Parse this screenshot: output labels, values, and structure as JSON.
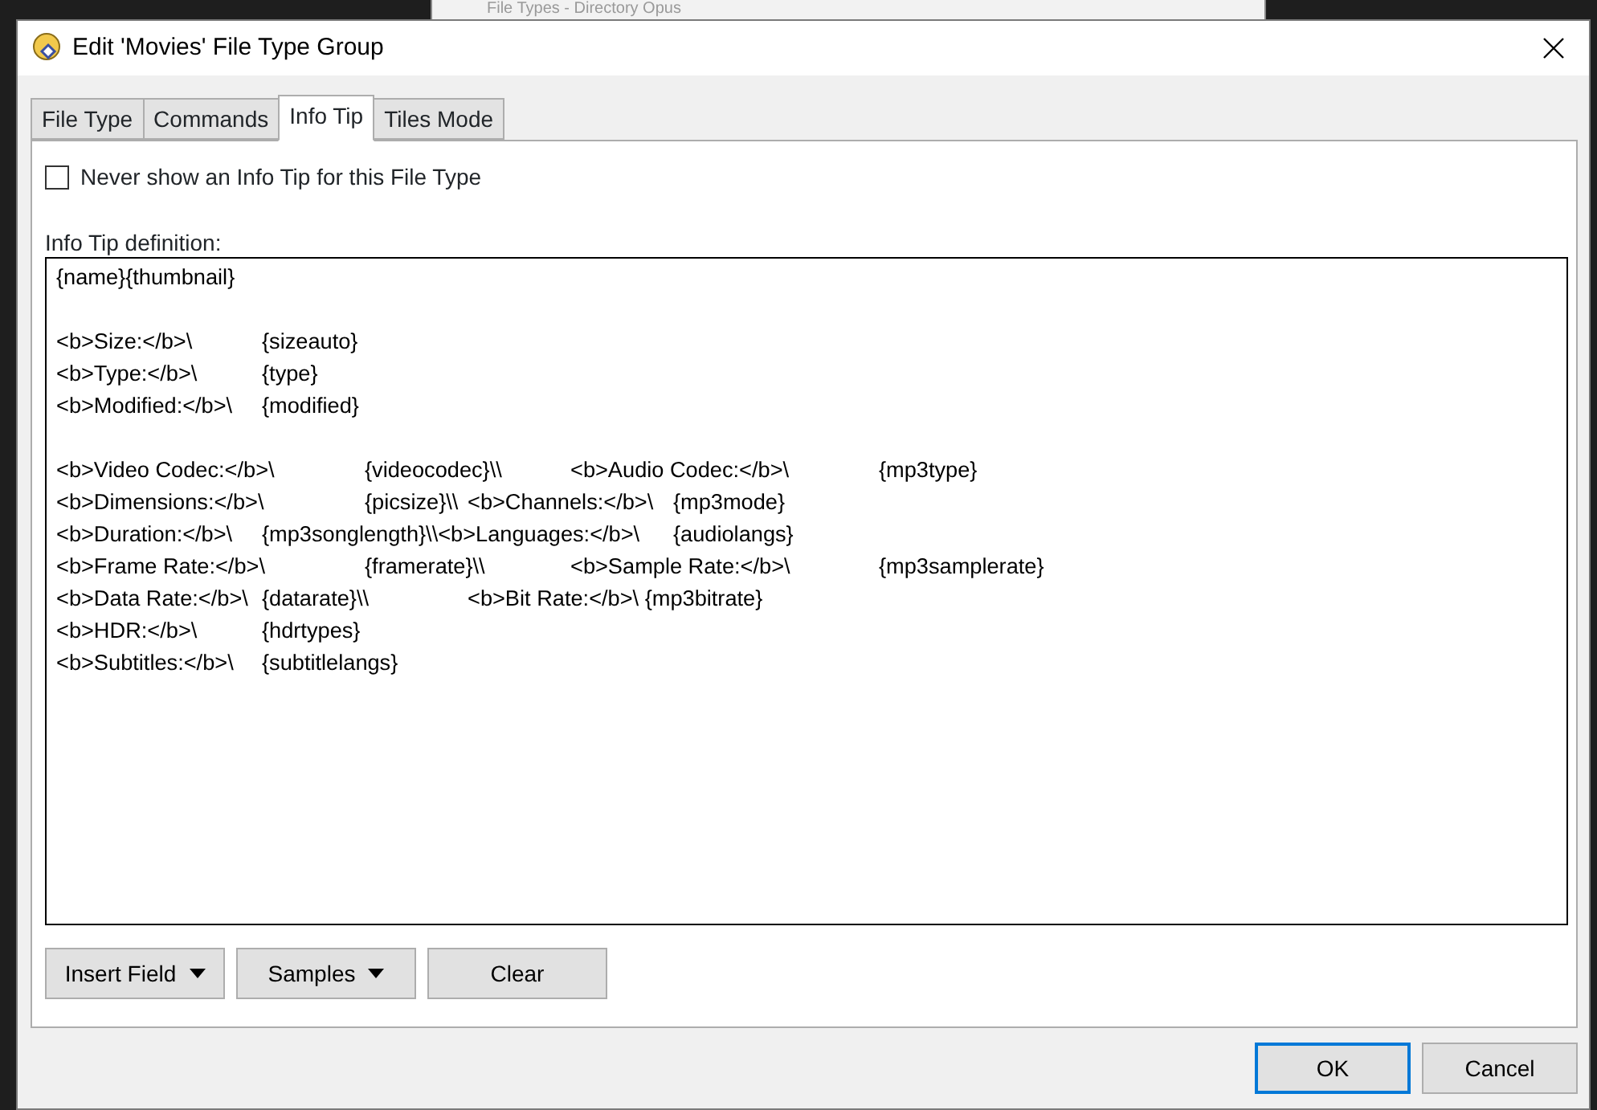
{
  "background_window": {
    "title": "File Types - Directory Opus"
  },
  "window": {
    "title": "Edit 'Movies' File Type Group"
  },
  "tabs": [
    {
      "label": "File Type",
      "selected": false
    },
    {
      "label": "Commands",
      "selected": false
    },
    {
      "label": "Info Tip",
      "selected": true
    },
    {
      "label": "Tiles Mode",
      "selected": false
    }
  ],
  "never_show": {
    "label": "Never show an Info Tip for this File Type",
    "checked": false
  },
  "definition": {
    "label": "Info Tip definition:",
    "value": "{name}{thumbnail}\n\n<b>Size:</b>\\\t{sizeauto}\n<b>Type:</b>\\\t{type}\n<b>Modified:</b>\\\t{modified}\n\n<b>Video Codec:</b>\\\t{videocodec}\\\\\t<b>Audio Codec:</b>\\\t{mp3type}\n<b>Dimensions:</b>\\\t{picsize}\\\\\t<b>Channels:</b>\\\t{mp3mode}\n<b>Duration:</b>\\\t{mp3songlength}\\\\<b>Languages:</b>\\\t{audiolangs}\n<b>Frame Rate:</b>\\\t{framerate}\\\\\t<b>Sample Rate:</b>\\\t{mp3samplerate}\n<b>Data Rate:</b>\\\t{datarate}\\\\\t<b>Bit Rate:</b>\\ {mp3bitrate}\n<b>HDR:</b>\\\t{hdrtypes}\n<b>Subtitles:</b>\\\t{subtitlelangs}"
  },
  "buttons": [
    {
      "label": "Insert Field",
      "kind": "dropdown"
    },
    {
      "label": "Samples",
      "kind": "dropdown"
    },
    {
      "label": "Clear",
      "kind": "plain"
    }
  ],
  "dialog_buttons": [
    {
      "label": "OK",
      "default": true
    },
    {
      "label": "Cancel",
      "default": false
    }
  ]
}
